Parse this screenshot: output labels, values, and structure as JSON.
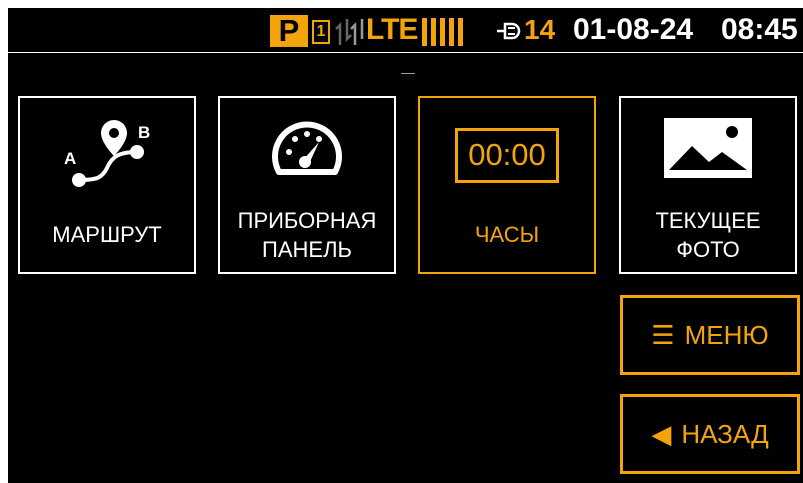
{
  "status_bar": {
    "parking_badge": "P",
    "sim_slot": "1",
    "network": "LTE",
    "satellite_count": "14",
    "date": "01-08-24",
    "time": "08:45",
    "accent_color": "#f2a40a"
  },
  "tiles": [
    {
      "label": "МАРШРУТ",
      "icon": "route-icon",
      "labels": [
        "A",
        "B"
      ]
    },
    {
      "label": "ПРИБОРНАЯ\nПАНЕЛЬ",
      "icon": "speedometer-icon"
    },
    {
      "label": "ЧАСЫ",
      "icon": "clock-display-icon",
      "clock_value": "00:00",
      "active": true
    },
    {
      "label": "ТЕКУЩЕЕ\nФОТО",
      "icon": "photo-icon"
    }
  ],
  "side_buttons": {
    "menu": {
      "label": "МЕНЮ",
      "icon": "hamburger-icon"
    },
    "back": {
      "label": "НАЗАД",
      "icon": "left-triangle-icon"
    }
  }
}
